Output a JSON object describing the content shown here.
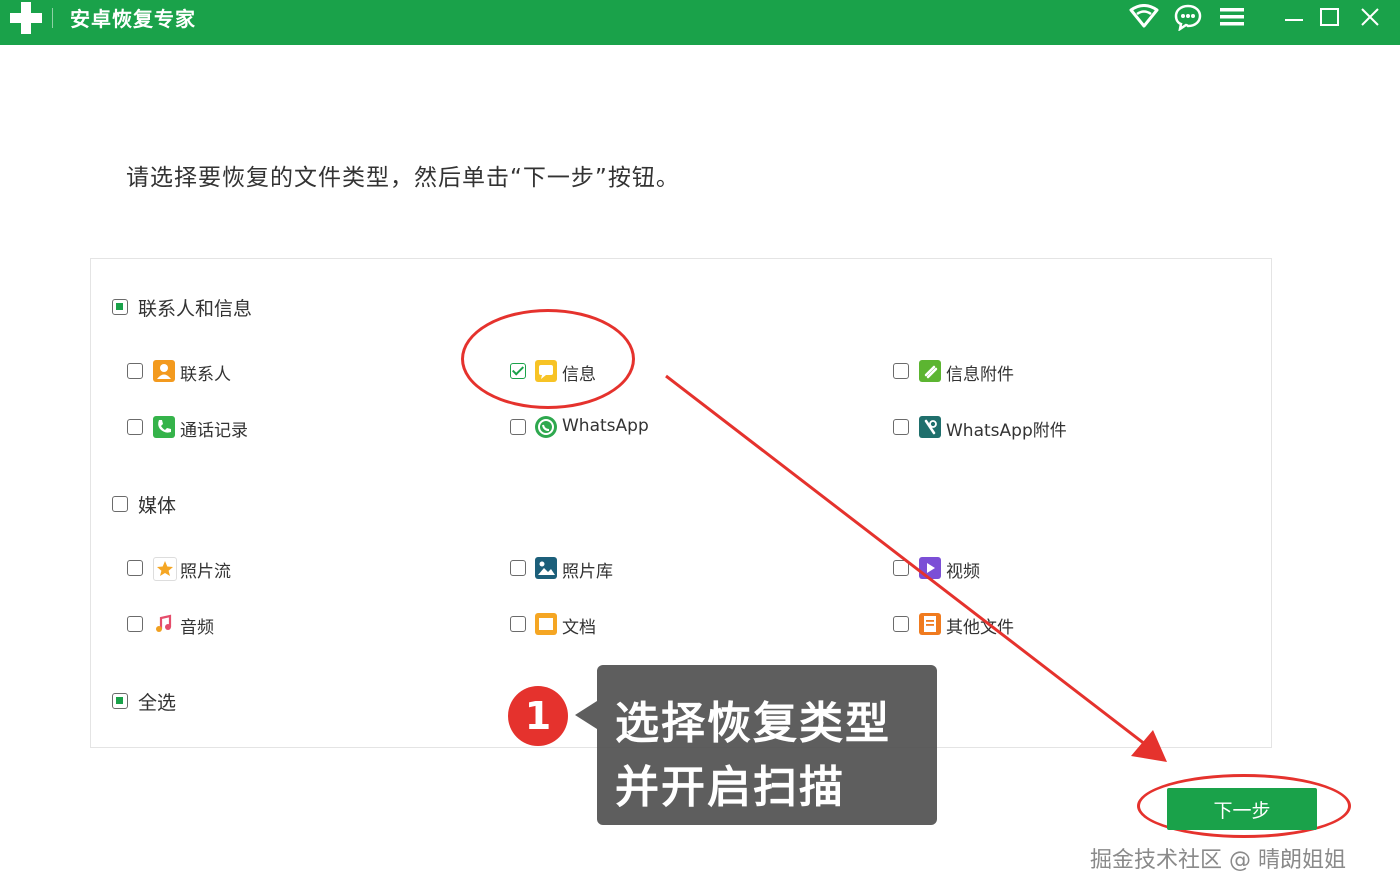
{
  "app": {
    "title": "安卓恢复专家"
  },
  "instruction": "请选择要恢复的文件类型，然后单击“下一步”按钮。",
  "groups": {
    "contacts_messages": {
      "label": "联系人和信息",
      "state": "partial",
      "items": [
        {
          "label": "联系人",
          "checked": false,
          "icon": "contact-icon"
        },
        {
          "label": "信息",
          "checked": true,
          "icon": "message-icon"
        },
        {
          "label": "信息附件",
          "checked": false,
          "icon": "attachment-icon"
        },
        {
          "label": "通话记录",
          "checked": false,
          "icon": "phone-icon"
        },
        {
          "label": "WhatsApp",
          "checked": false,
          "icon": "whatsapp-icon"
        },
        {
          "label": "WhatsApp附件",
          "checked": false,
          "icon": "whatsapp-attachment-icon"
        }
      ]
    },
    "media": {
      "label": "媒体",
      "state": "unchecked",
      "items": [
        {
          "label": "照片流",
          "checked": false,
          "icon": "photostream-icon"
        },
        {
          "label": "照片库",
          "checked": false,
          "icon": "photo-library-icon"
        },
        {
          "label": "视频",
          "checked": false,
          "icon": "video-icon"
        },
        {
          "label": "音频",
          "checked": false,
          "icon": "audio-icon"
        },
        {
          "label": "文档",
          "checked": false,
          "icon": "document-icon"
        },
        {
          "label": "其他文件",
          "checked": false,
          "icon": "other-files-icon"
        }
      ]
    }
  },
  "select_all": {
    "label": "全选",
    "state": "partial"
  },
  "next_button": {
    "label": "下一步"
  },
  "annotation": {
    "step": "1",
    "line1": "选择恢复类型",
    "line2": "并开启扫描"
  },
  "watermark": "掘金技术社区 @ 晴朗姐姐",
  "colors": {
    "brand_green": "#1aa24a",
    "annotation_red": "#e5322d"
  }
}
